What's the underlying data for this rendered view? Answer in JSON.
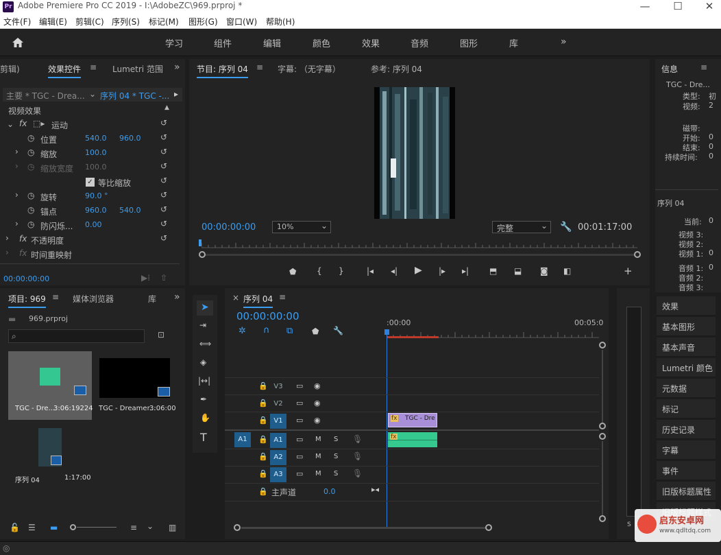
{
  "window": {
    "app_badge": "Pr",
    "title": "Adobe Premiere Pro CC 2019 - I:\\AdobeZC\\969.prproj *",
    "controls": [
      "—",
      "☐",
      "✕"
    ]
  },
  "menu": [
    "文件(F)",
    "编辑(E)",
    "剪辑(C)",
    "序列(S)",
    "标记(M)",
    "图形(G)",
    "窗口(W)",
    "帮助(H)"
  ],
  "workspaces": [
    "学习",
    "组件",
    "编辑",
    "颜色",
    "效果",
    "音频",
    "图形",
    "库"
  ],
  "effect_controls": {
    "tabs": [
      "剪辑)",
      "效果控件",
      "Lumetri 范围"
    ],
    "master_label": "主要 * TGC - Drea...",
    "sequence_label": "序列 04 * TGC -...",
    "video_effects_label": "视频效果",
    "motion_label": "运动",
    "props": {
      "position": {
        "label": "位置",
        "x": "540.0",
        "y": "960.0"
      },
      "scale": {
        "label": "缩放",
        "value": "100.0"
      },
      "scale_width": {
        "label": "缩放宽度",
        "value": "100.0"
      },
      "uniform": {
        "label": "等比缩放"
      },
      "rotation": {
        "label": "旋转",
        "value": "90.0 °"
      },
      "anchor": {
        "label": "锚点",
        "x": "960.0",
        "y": "540.0"
      },
      "flicker": {
        "label": "防闪烁...",
        "value": "0.00"
      }
    },
    "opacity_label": "不透明度",
    "time_remap_label": "时间重映射",
    "timecode": "00:00:00:00"
  },
  "program": {
    "tabs": [
      "节目: 序列 04",
      "字幕: （无字幕）",
      "参考: 序列 04"
    ],
    "timecode": "00:00:00:00",
    "zoom": "10%",
    "quality": "完整",
    "duration": "00:01:17:00"
  },
  "info": {
    "title": "信息",
    "clip_name": "TGC - Dre...",
    "labels": [
      "类型:",
      "视频:",
      "磁带:",
      "开始:",
      "结束:",
      "持续时间:"
    ],
    "values": [
      "初",
      "2",
      "",
      "0",
      "0",
      "0"
    ],
    "sequence_title": "序列 04",
    "seq_labels": [
      "当前:",
      "视频 3:",
      "视频 2:",
      "视频 1:",
      "音频 1:",
      "音频 2:",
      "音频 3:"
    ],
    "seq_values": [
      "0",
      "",
      "",
      "0",
      "0",
      "",
      ""
    ]
  },
  "side_panels": [
    "效果",
    "基本图形",
    "基本声音",
    "Lumetri 颜色",
    "元数据",
    "标记",
    "历史记录",
    "字幕",
    "事件",
    "旧版标题属性",
    "旧版标题样式"
  ],
  "project": {
    "tabs": [
      "项目: 969",
      "媒体浏览器",
      "库"
    ],
    "filename": "969.prproj",
    "items": [
      {
        "name": "TGC - Dre...",
        "duration": "3:06:19224"
      },
      {
        "name": "TGC - Dreamer...",
        "duration": "3:06:00"
      },
      {
        "name": "序列 04",
        "duration": "1:17:00"
      }
    ]
  },
  "timeline": {
    "tab": "序列 04",
    "timecode": "00:00:00:00",
    "ruler": [
      ":00:00",
      "00:05:0"
    ],
    "video_tracks": [
      "V3",
      "V2",
      "V1"
    ],
    "audio_tracks": [
      "A1",
      "A2",
      "A3"
    ],
    "source_patch": "A1",
    "master_label": "主声道",
    "master_value": "0.0",
    "clip_label": "TGC - Dre",
    "fx_label": "fx",
    "mute": "M",
    "solo": "S"
  },
  "meter_labels": [
    "S",
    "S"
  ],
  "watermark": {
    "title": "启东安卓网",
    "url": "www.qdltdq.com"
  },
  "colors": {
    "accent": "#3c9df0",
    "video_clip": "#a98fd8",
    "audio_clip": "#35c98f",
    "playhead": "#2f7fe0",
    "workarea": "#c0392b"
  }
}
